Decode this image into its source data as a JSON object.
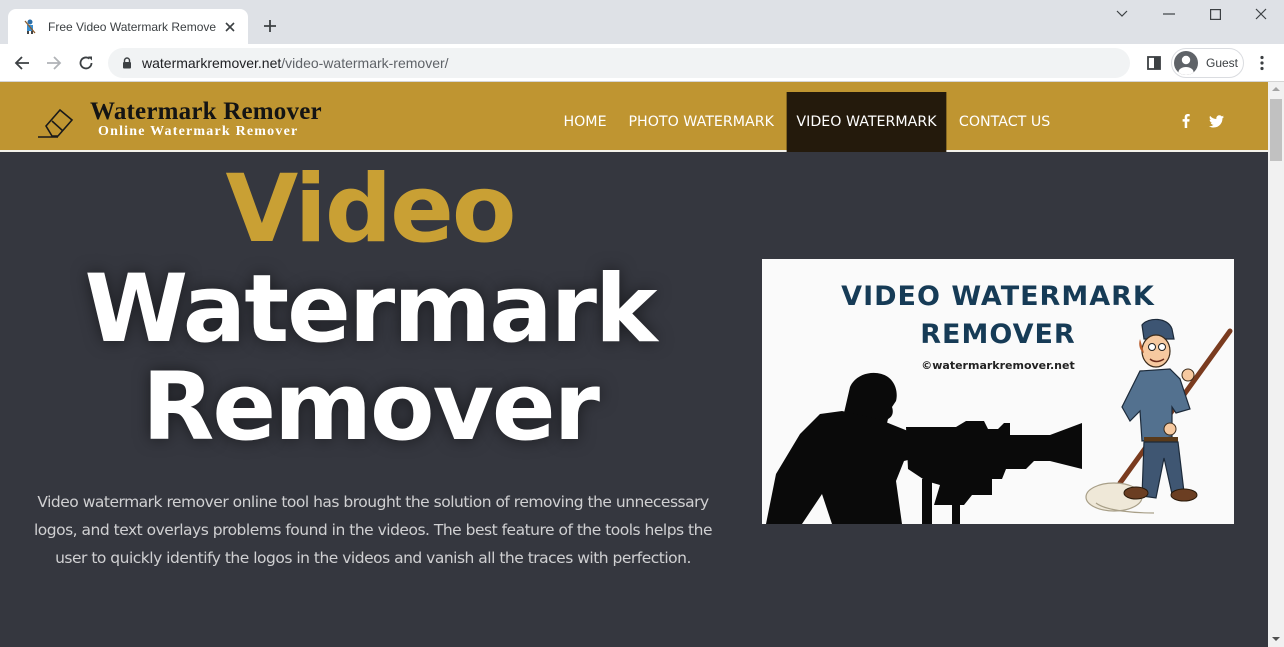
{
  "browser": {
    "tab_title": "Free Video Watermark Remover Online",
    "new_tab_label": "+",
    "url_domain": "watermarkremover.net",
    "url_path": "/video-watermark-remover/",
    "profile_label": "Guest"
  },
  "site": {
    "logo_title": "Watermark Remover",
    "logo_subtitle": "Online Watermark Remover",
    "nav": [
      {
        "label": "HOME",
        "active": false
      },
      {
        "label": "PHOTO WATERMARK",
        "active": false
      },
      {
        "label": "VIDEO WATERMARK",
        "active": true
      },
      {
        "label": "CONTACT US",
        "active": false
      }
    ],
    "social": [
      "facebook-icon",
      "twitter-icon"
    ],
    "brand_color": "#bf9531",
    "accent_color": "#c9a034",
    "active_nav_color": "#241a0c"
  },
  "hero": {
    "title_line1": "Video",
    "title_line2": "Watermark",
    "title_line3": "Remover",
    "description": "Video watermark remover online tool has brought the solution of removing the unnecessary logos, and text overlays problems found in the videos. The best feature of the tools helps the user to quickly identify the logos in the videos and vanish all the traces with perfection.",
    "image": {
      "title_line1": "VIDEO WATERMARK",
      "title_line2": "REMOVER",
      "copyright": "©watermarkremover.net"
    }
  }
}
